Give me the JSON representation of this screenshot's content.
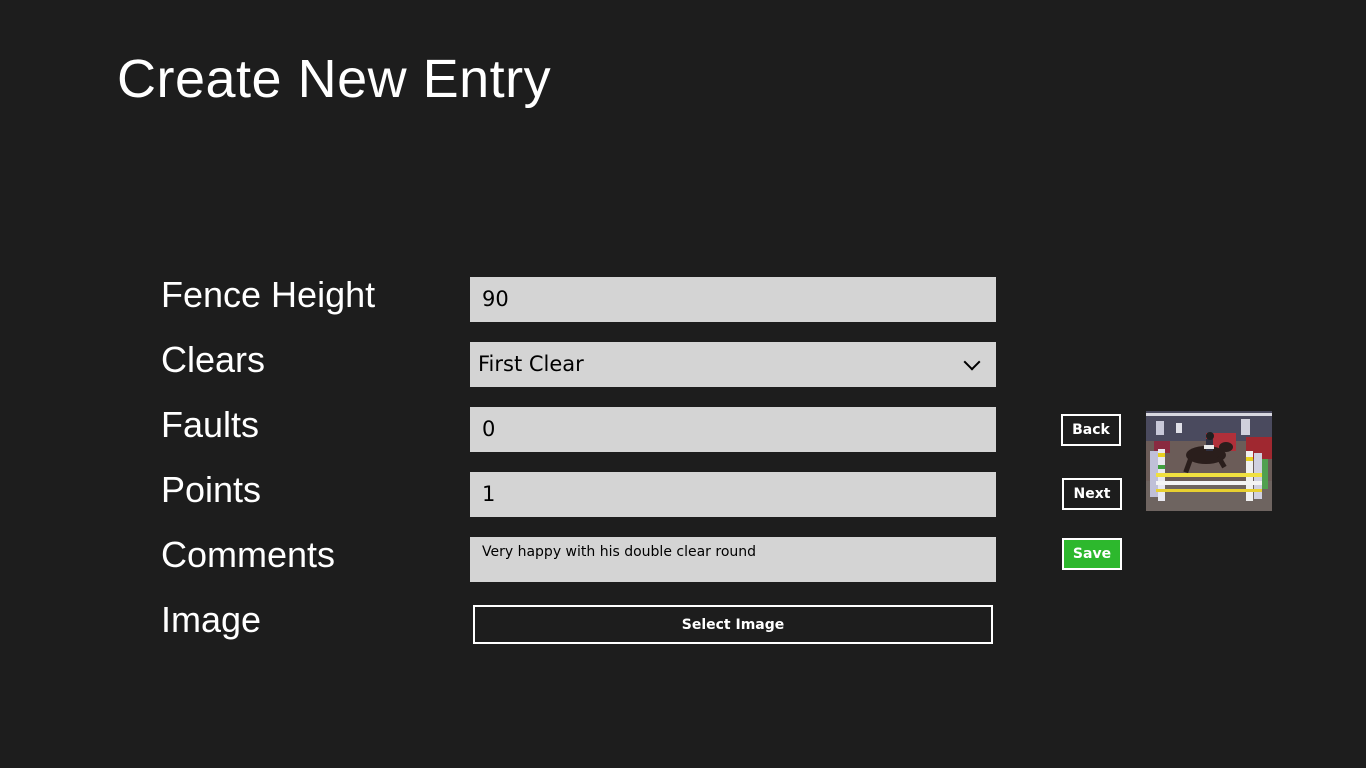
{
  "page": {
    "title": "Create New Entry"
  },
  "form": {
    "fence_height": {
      "label": "Fence Height",
      "value": "90"
    },
    "clears": {
      "label": "Clears",
      "selected": "First Clear"
    },
    "faults": {
      "label": "Faults",
      "value": "0"
    },
    "points": {
      "label": "Points",
      "value": "1"
    },
    "comments": {
      "label": "Comments",
      "value": "Very happy with his double clear round"
    },
    "image": {
      "label": "Image",
      "button_label": "Select Image"
    }
  },
  "actions": {
    "back_label": "Back",
    "next_label": "Next",
    "save_label": "Save"
  },
  "colors": {
    "background": "#1d1d1d",
    "field_background": "#d4d4d4",
    "save_accent": "#2db82d"
  },
  "thumbnail": {
    "icon": "horse-jumping-photo"
  }
}
